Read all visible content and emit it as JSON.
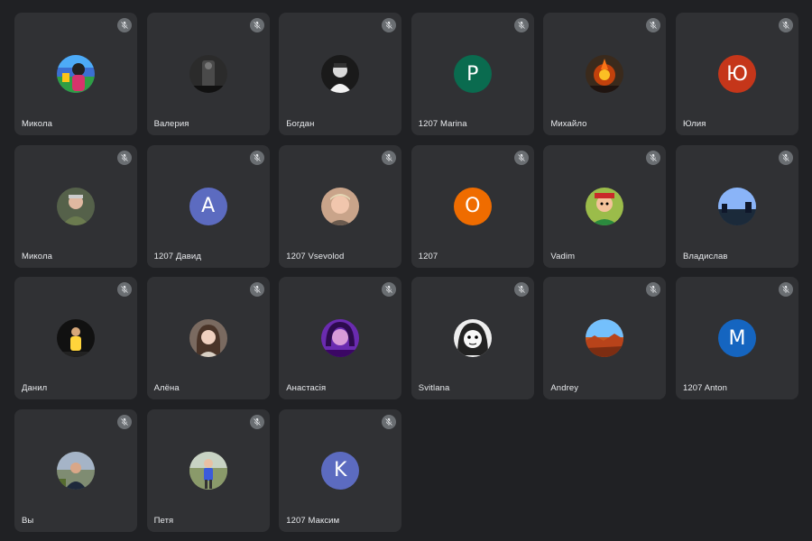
{
  "participants": [
    {
      "name": "Микола",
      "avatar": "photo",
      "photo": "flag-person",
      "bg": "#3b6fd1",
      "muted": true
    },
    {
      "name": "Валерия",
      "avatar": "photo",
      "photo": "dark-figure",
      "bg": "#2b2b2b",
      "muted": true
    },
    {
      "name": "Богдан",
      "avatar": "photo",
      "photo": "bw-portrait",
      "bg": "#1a1a1a",
      "muted": true
    },
    {
      "name": "1207 Marina",
      "avatar": "letter",
      "letter": "P",
      "bg": "#0a6b4f",
      "muted": true
    },
    {
      "name": "Михайло",
      "avatar": "photo",
      "photo": "fire-art",
      "bg": "#3a2a1c",
      "muted": true
    },
    {
      "name": "Юлия",
      "avatar": "letter",
      "letter": "Ю",
      "bg": "#c5361a",
      "muted": true
    },
    {
      "name": "Микола",
      "avatar": "photo",
      "photo": "soldier",
      "bg": "#55614a",
      "muted": true
    },
    {
      "name": "1207 Давид",
      "avatar": "letter",
      "letter": "A",
      "bg": "#5c6bc0",
      "muted": true
    },
    {
      "name": "1207 Vsevolod",
      "avatar": "photo",
      "photo": "young-man",
      "bg": "#c9a48a",
      "muted": true
    },
    {
      "name": "1207",
      "avatar": "letter",
      "letter": "O",
      "bg": "#ef6c00",
      "muted": true
    },
    {
      "name": "Vadim",
      "avatar": "photo",
      "photo": "cartoon",
      "bg": "#9bbc4a",
      "muted": true
    },
    {
      "name": "Владислав",
      "avatar": "photo",
      "photo": "night-city",
      "bg": "#2c4a6e",
      "muted": true
    },
    {
      "name": "Данил",
      "avatar": "photo",
      "photo": "dark-yellow",
      "bg": "#111111",
      "muted": true
    },
    {
      "name": "Алёна",
      "avatar": "photo",
      "photo": "girl",
      "bg": "#7a6a60",
      "muted": true
    },
    {
      "name": "Анастасія",
      "avatar": "photo",
      "photo": "purple-girl",
      "bg": "#6a2bb0",
      "muted": true
    },
    {
      "name": "Svitlana",
      "avatar": "photo",
      "photo": "bw-sketch",
      "bg": "#eeeeee",
      "muted": true
    },
    {
      "name": "Andrey",
      "avatar": "photo",
      "photo": "canyon",
      "bg": "#c4571e",
      "muted": true
    },
    {
      "name": "1207 Anton",
      "avatar": "letter",
      "letter": "M",
      "bg": "#1565c0",
      "muted": true
    },
    {
      "name": "Вы",
      "avatar": "photo",
      "photo": "man-outdoor",
      "bg": "#7f8c72",
      "muted": true
    },
    {
      "name": "Петя",
      "avatar": "photo",
      "photo": "boy-field",
      "bg": "#9aa389",
      "muted": true
    },
    {
      "name": "1207 Максим",
      "avatar": "letter",
      "letter": "K",
      "bg": "#5c6bc0",
      "muted": true
    }
  ],
  "icons": {
    "mic_off": "mic-off-icon"
  },
  "colors": {
    "background": "#202124",
    "tile": "#303134",
    "text": "#e8eaed"
  }
}
